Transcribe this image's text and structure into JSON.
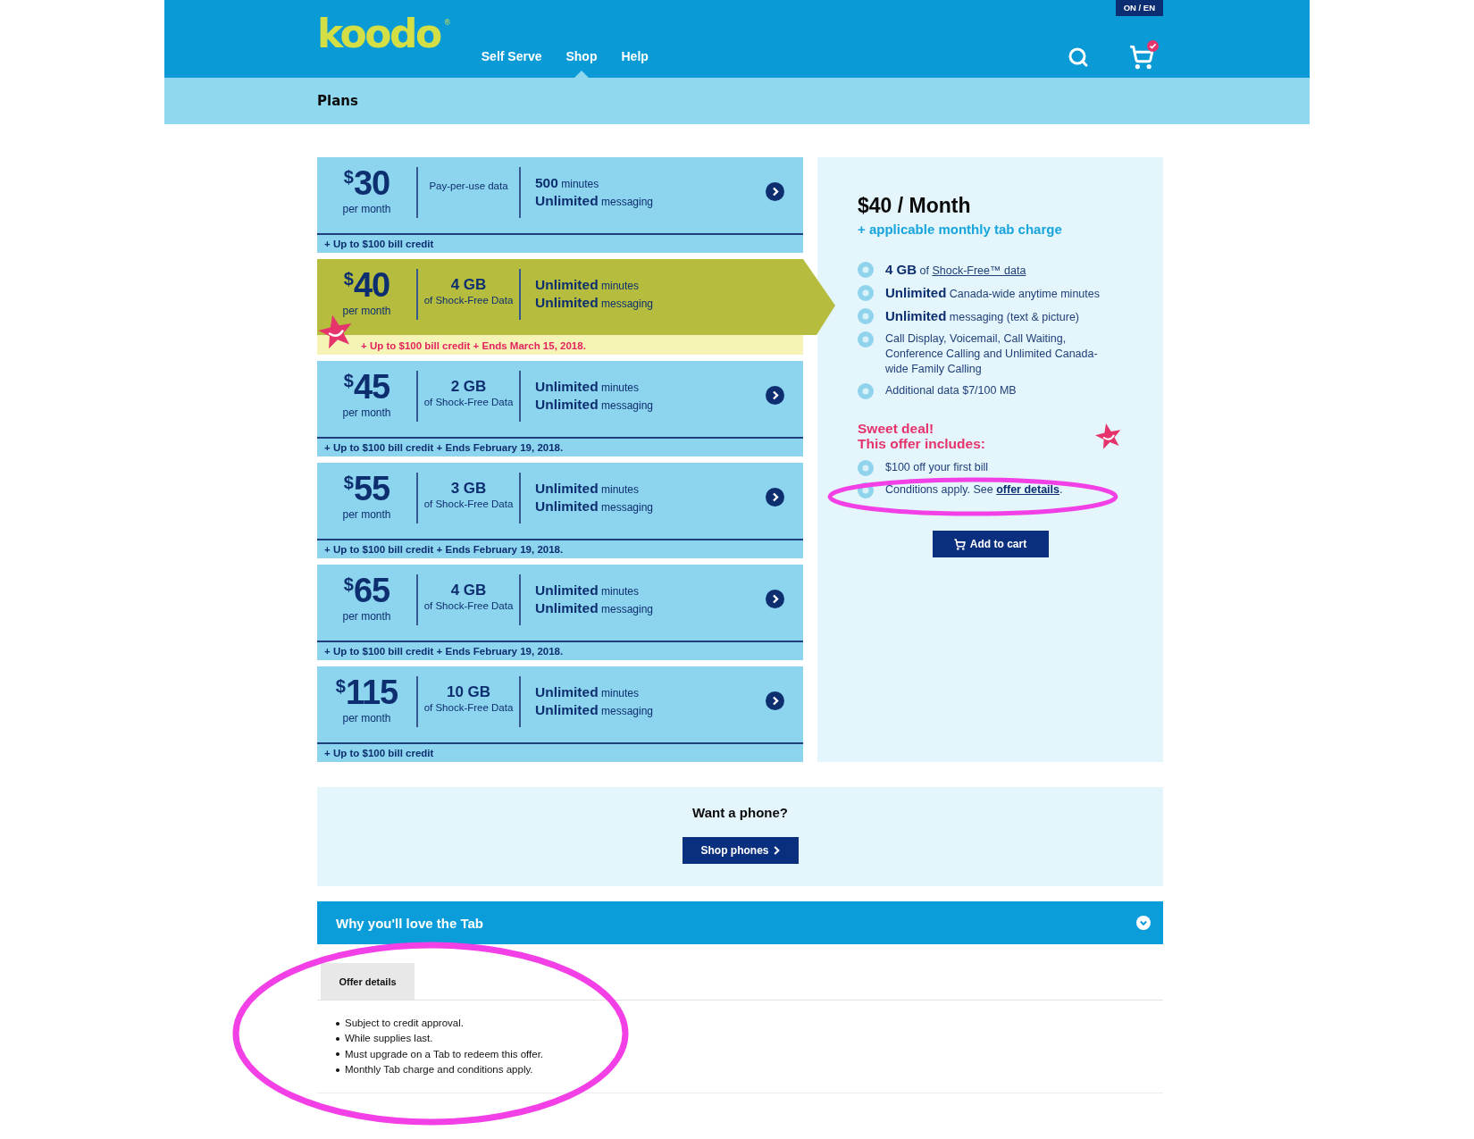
{
  "header": {
    "logo": "koodo",
    "logo_mark": "®",
    "nav": [
      {
        "label": "Self Serve",
        "selected": false
      },
      {
        "label": "Shop",
        "selected": true
      },
      {
        "label": "Help",
        "selected": false
      }
    ],
    "language": "ON / EN"
  },
  "subheader": {
    "title": "Plans"
  },
  "plans": [
    {
      "currency": "$",
      "amount": "30",
      "period": "per month",
      "data": {
        "label": "Pay-per-use data"
      },
      "features": [
        {
          "value": "500",
          "unit": "minutes"
        },
        {
          "value": "Unlimited",
          "unit": "messaging"
        }
      ],
      "credit": "+ Up to $100 bill credit",
      "selected": false
    },
    {
      "currency": "$",
      "amount": "40",
      "period": "per month",
      "data": {
        "amount": "4 GB",
        "label": "of Shock-Free Data"
      },
      "features": [
        {
          "value": "Unlimited",
          "unit": "minutes"
        },
        {
          "value": "Unlimited",
          "unit": "messaging"
        }
      ],
      "credit": "+ Up to $100 bill credit + Ends March 15, 2018.",
      "selected": true
    },
    {
      "currency": "$",
      "amount": "45",
      "period": "per month",
      "data": {
        "amount": "2 GB",
        "label": "of Shock-Free Data"
      },
      "features": [
        {
          "value": "Unlimited",
          "unit": "minutes"
        },
        {
          "value": "Unlimited",
          "unit": "messaging"
        }
      ],
      "credit": "+ Up to $100 bill credit + Ends February 19, 2018.",
      "selected": false
    },
    {
      "currency": "$",
      "amount": "55",
      "period": "per month",
      "data": {
        "amount": "3 GB",
        "label": "of Shock-Free Data"
      },
      "features": [
        {
          "value": "Unlimited",
          "unit": "minutes"
        },
        {
          "value": "Unlimited",
          "unit": "messaging"
        }
      ],
      "credit": "+ Up to $100 bill credit + Ends February 19, 2018.",
      "selected": false
    },
    {
      "currency": "$",
      "amount": "65",
      "period": "per month",
      "data": {
        "amount": "4 GB",
        "label": "of Shock-Free Data"
      },
      "features": [
        {
          "value": "Unlimited",
          "unit": "minutes"
        },
        {
          "value": "Unlimited",
          "unit": "messaging"
        }
      ],
      "credit": "+ Up to $100 bill credit + Ends February 19, 2018.",
      "selected": false
    },
    {
      "currency": "$",
      "amount": "115",
      "period": "per month",
      "data": {
        "amount": "10 GB",
        "label": "of Shock-Free Data"
      },
      "features": [
        {
          "value": "Unlimited",
          "unit": "minutes"
        },
        {
          "value": "Unlimited",
          "unit": "messaging"
        }
      ],
      "credit": "+ Up to $100 bill credit",
      "selected": false
    }
  ],
  "plan_detail": {
    "title": "$40 / Month",
    "subtitle": "+ applicable monthly tab charge",
    "features": [
      {
        "bold": "4 GB",
        "text": "of",
        "link": "Shock-Free™ data"
      },
      {
        "bold": "Unlimited",
        "text": "Canada-wide anytime minutes"
      },
      {
        "bold": "Unlimited",
        "text": "messaging (text & picture)"
      },
      {
        "text": "Call Display, Voicemail, Call Waiting, Conference Calling and Unlimited Canada-wide Family Calling"
      },
      {
        "text": "Additional data $7/100 MB"
      }
    ],
    "offer_heading": [
      "Sweet deal!",
      "This offer includes:"
    ],
    "offer_items": [
      {
        "text": "$100 off your first bill"
      },
      {
        "text": "Conditions apply. See",
        "link": "offer details",
        "end": "."
      }
    ],
    "button": "Add to cart"
  },
  "phone_promo": {
    "title": "Want a phone?",
    "button": "Shop phones"
  },
  "accordion": {
    "title": "Why you'll love the Tab",
    "expanded": false
  },
  "offer_tabs": [
    {
      "label": "Offer details",
      "selected": true
    }
  ],
  "offer_details": [
    "Subject to credit approval.",
    "While supplies last.",
    "Must upgrade on a Tab to redeem this offer.",
    "Monthly Tab charge and conditions apply."
  ]
}
